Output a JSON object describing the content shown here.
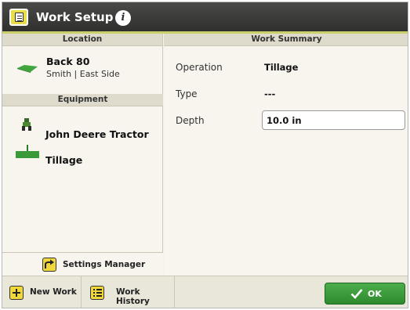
{
  "window": {
    "title": "Work Setup"
  },
  "location": {
    "header": "Location",
    "name": "Back 80",
    "sub": "Smith | East Side"
  },
  "equipment": {
    "header": "Equipment",
    "items": [
      {
        "label": "John Deere Tractor",
        "icon": "tractor-icon"
      },
      {
        "label": "Tillage",
        "icon": "implement-icon"
      }
    ]
  },
  "settings_manager": {
    "label": "Settings Manager",
    "icon": "arrow-turn-icon"
  },
  "work_summary": {
    "header": "Work Summary",
    "rows": [
      {
        "label": "Operation",
        "value": "Tillage"
      },
      {
        "label": "Type",
        "value": "---"
      },
      {
        "label": "Depth",
        "value": "10.0 in"
      }
    ]
  },
  "bottom": {
    "new_work": "New Work",
    "work_history": "Work History",
    "ok": "OK"
  },
  "colors": {
    "accent_green": "#3a9a39",
    "accent_yellow": "#f0d83a",
    "titlebar": "#3a3a38"
  }
}
